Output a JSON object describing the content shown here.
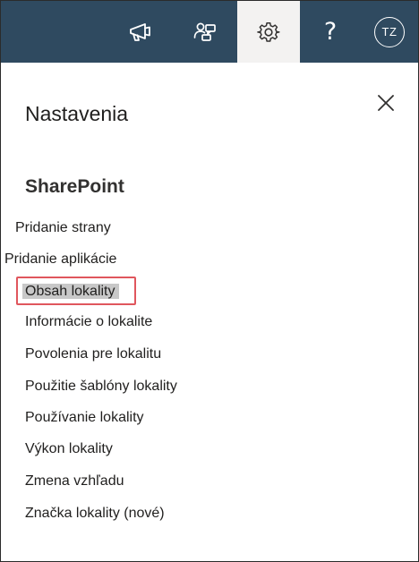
{
  "topbar": {
    "background": "#2f4a60",
    "icons": [
      {
        "name": "megaphone-icon",
        "label": "What's new"
      },
      {
        "name": "feedback-icon",
        "label": "Feedback"
      },
      {
        "name": "gear-icon",
        "label": "Settings",
        "active": true
      },
      {
        "name": "help-icon",
        "glyph": "?"
      }
    ],
    "avatar_initials": "TZ"
  },
  "panel": {
    "title": "Nastavenia",
    "close_icon": "close-icon",
    "section_title": "SharePoint",
    "links": [
      {
        "label": "Pridanie strany"
      },
      {
        "label": "Pridanie aplikácie"
      },
      {
        "label": "Obsah lokality",
        "selected": true
      },
      {
        "label": "Informácie o lokalite"
      },
      {
        "label": "Povolenia pre lokalitu"
      },
      {
        "label": "Použitie šablóny lokality"
      },
      {
        "label": "Používanie lokality"
      },
      {
        "label": "Výkon lokality"
      },
      {
        "label": "Zmena vzhľadu"
      },
      {
        "label": "Značka lokality (nové)"
      }
    ],
    "highlight_color": "#e0565d",
    "selected_background": "#c8c8c8"
  }
}
